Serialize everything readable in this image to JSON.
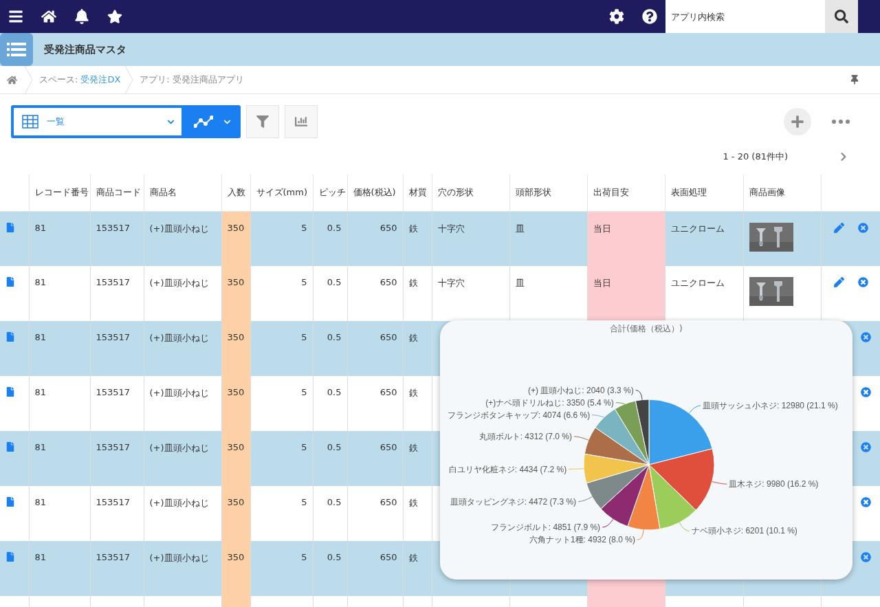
{
  "top_bar": {
    "search": {
      "placeholder": "アプリ内検索"
    }
  },
  "app_title": "受発注商品マスタ",
  "breadcrumb": [
    {
      "label": "スペース:",
      "link": "受発注DX"
    },
    {
      "label": "アプリ: 受発注商品アプリ"
    }
  ],
  "view_select": {
    "value": "一覧"
  },
  "pager": {
    "range": "1 - 20 (81件中)"
  },
  "table": {
    "columns": [
      "レコード番号",
      "商品コード",
      "商品名",
      "入数",
      "サイズ(mm)",
      "ピッチ",
      "価格(税込)",
      "材質",
      "穴の形状",
      "頭部形状",
      "出荷目安",
      "表面処理",
      "商品画像"
    ],
    "rows": [
      {
        "cells": [
          "81",
          "153517",
          "(+)皿頭小ねじ",
          "350",
          "5",
          "0.5",
          "650",
          "鉄",
          "十字穴",
          "皿",
          "当日",
          "ユニクローム"
        ],
        "image": true,
        "edit": true,
        "delete": true
      },
      {
        "cells": [
          "81",
          "153517",
          "(+)皿頭小ねじ",
          "350",
          "5",
          "0.5",
          "650",
          "鉄",
          "十字穴",
          "皿",
          "当日",
          "ユニクローム"
        ],
        "image": true,
        "edit": true,
        "delete": true
      },
      {
        "cells": [
          "81",
          "153517",
          "(+)皿頭小ねじ",
          "350",
          "5",
          "0.5",
          "650",
          "鉄"
        ],
        "image": false,
        "edit": false,
        "delete": true
      },
      {
        "cells": [
          "81",
          "153517",
          "(+)皿頭小ねじ",
          "350",
          "5",
          "0.5",
          "650",
          "鉄"
        ],
        "image": false,
        "edit": false,
        "delete": true
      },
      {
        "cells": [
          "81",
          "153517",
          "(+)皿頭小ねじ",
          "350",
          "5",
          "0.5",
          "650",
          "鉄"
        ],
        "image": false,
        "edit": false,
        "delete": true
      },
      {
        "cells": [
          "81",
          "153517",
          "(+)皿頭小ねじ",
          "350",
          "5",
          "0.5",
          "650",
          "鉄"
        ],
        "image": false,
        "edit": false,
        "delete": true
      },
      {
        "cells": [
          "81",
          "153517",
          "(+)皿頭小ねじ",
          "350",
          "5",
          "0.5",
          "650",
          "鉄"
        ],
        "image": false,
        "edit": false,
        "delete": true
      },
      {
        "cells": []
      }
    ]
  },
  "chart_popup": {
    "chart_data": {
      "type": "pie",
      "title": "合計(価格（税込）)",
      "values": [
        12980,
        9980,
        6201,
        4932,
        4851,
        4472,
        4434,
        4312,
        4074,
        3350,
        2040
      ],
      "colors": [
        "#3aa0ec",
        "#e04e3c",
        "#9ccc5a",
        "#f28444",
        "#8e2a70",
        "#7e8a8a",
        "#f2c44c",
        "#ab6e48",
        "#7ab4c0",
        "#7a9e56",
        "#444444"
      ],
      "value_labels": [
        "皿頭サッシュ小ネジ: 12980 (21.1 %)",
        "皿木ネジ: 9980 (16.2 %)",
        "ナベ頭小ネジ: 6201 (10.1 %)",
        "六角ナット1種: 4932 (8.0 %)",
        "フランジボルト: 4851 (7.9 %)",
        "皿頭タッピングネジ: 4472 (7.3 %)",
        "白ユリヤ化粧ネジ: 4434 (7.2 %)",
        "丸頭ボルト: 4312 (7.0 %)",
        "フランジボタンキャップ: 4074 (6.6 %)",
        "(+)ナベ頭ドリルねじ: 3350 (5.4 %)",
        "(+) 皿頭小ねじ: 2040 (3.3 %)"
      ]
    }
  }
}
